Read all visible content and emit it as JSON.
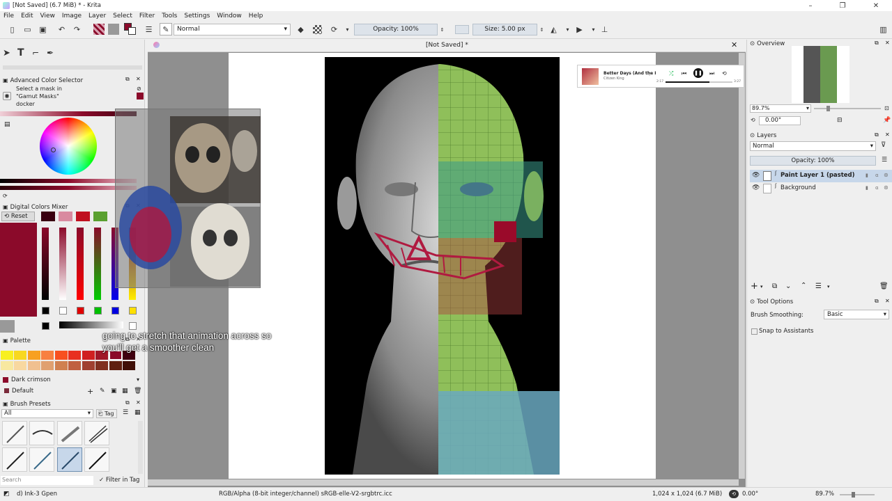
{
  "window": {
    "title": "[Not Saved]  (6.7 MiB)  * - Krita"
  },
  "menu": [
    "File",
    "Edit",
    "View",
    "Image",
    "Layer",
    "Select",
    "Filter",
    "Tools",
    "Settings",
    "Window",
    "Help"
  ],
  "toolbar": {
    "blend_mode": "Normal",
    "opacity": "Opacity: 100%",
    "size": "Size: 5.00 px"
  },
  "canvas": {
    "tab_title": "[Not Saved]  *"
  },
  "left_dock": {
    "advanced_color_selector": {
      "title": "Advanced Color Selector",
      "hint": [
        "Select a mask in",
        "\"Gamut Masks\"",
        "docker"
      ]
    },
    "digital_colors_mixer": {
      "title": "Digital Colors Mixer",
      "reset_label": "Reset"
    },
    "palette": {
      "title": "Palette",
      "selected_color_name": "Dark crimson",
      "palette_name": "Default"
    },
    "brush_presets": {
      "title": "Brush Presets",
      "filter_value": "All",
      "tag_label": "Tag",
      "search_placeholder": "Search",
      "filter_in_tag_label": "Filter in Tag"
    }
  },
  "media_player": {
    "track": "Better Days (And the I",
    "artist": "Citizen King",
    "time_elapsed": "2:17",
    "time_total": "3:27"
  },
  "subtitle": {
    "line1": "going to stretch that animation across so",
    "line2": "you'll get a smoother clean"
  },
  "right_dock": {
    "overview": {
      "title": "Overview",
      "zoom": "89.7%",
      "rotation": "0.00°"
    },
    "layers": {
      "title": "Layers",
      "blend_mode": "Normal",
      "opacity": "Opacity:  100%",
      "items": [
        {
          "name": "Paint Layer 1 (pasted)",
          "selected": true
        },
        {
          "name": "Background",
          "selected": false
        }
      ]
    },
    "tool_options": {
      "title": "Tool Options",
      "brush_smoothing_label": "Brush Smoothing:",
      "brush_smoothing_value": "Basic",
      "snap_label": "Snap to Assistants"
    }
  },
  "status": {
    "brush": "d) Ink-3 Gpen",
    "color_space": "RGB/Alpha (8-bit integer/channel)  sRGB-elle-V2-srgbtrc.icc",
    "dimensions": "1,024 x 1,024 (6.7 MiB)",
    "rotation": "0.00°",
    "zoom": "89.7%"
  },
  "colors": {
    "foreground": "#8b0a2a",
    "accent_selection": "#c7d7ea"
  }
}
